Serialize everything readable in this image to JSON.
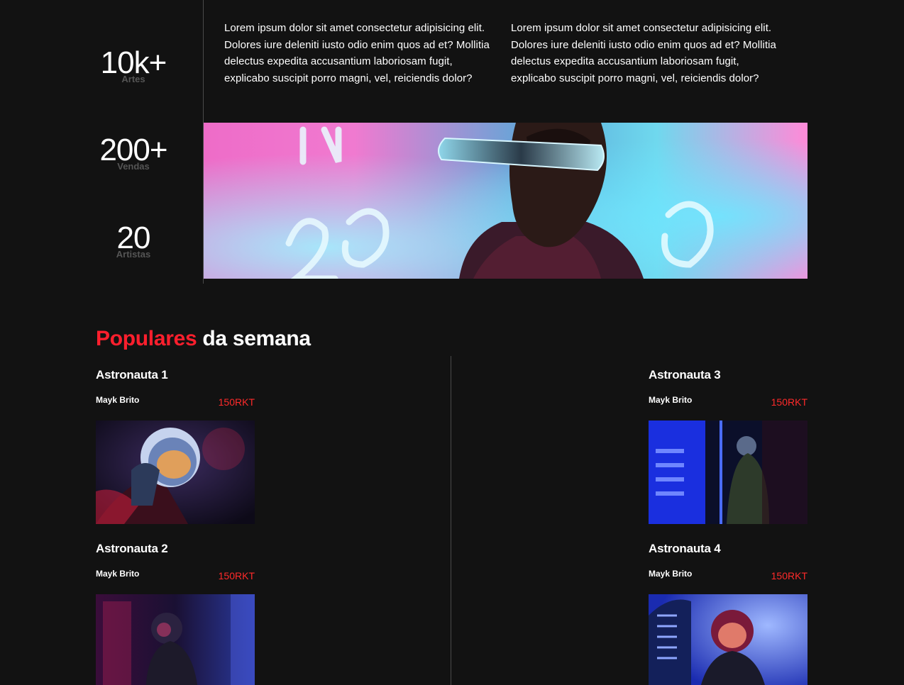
{
  "stats": [
    {
      "value": "10k+",
      "label": "Artes"
    },
    {
      "value": "200+",
      "label": "Vendas"
    },
    {
      "value": "20",
      "label": "Artistas"
    }
  ],
  "intro": {
    "paragraph_1": "Lorem ipsum dolor sit amet consectetur adipisicing elit. Dolores iure deleniti iusto odio enim quos ad et? Mollitia delectus expedita accusantium laboriosam fugit, explicabo suscipit porro magni, vel, reiciendis dolor?",
    "paragraph_2": "Lorem ipsum dolor sit amet consectetur adipisicing elit. Dolores iure deleniti iusto odio enim quos ad et? Mollitia delectus expedita accusantium laboriosam fugit, explicabo suscipit porro magni, vel, reiciendis dolor?"
  },
  "populares": {
    "title_accent": "Populares",
    "title_rest": " da semana",
    "items": [
      {
        "title": "Astronauta 1",
        "artist": "Mayk Brito",
        "price": "150RKT"
      },
      {
        "title": "Astronauta 2",
        "artist": "Mayk Brito",
        "price": "150RKT"
      },
      {
        "title": "Astronauta 3",
        "artist": "Mayk Brito",
        "price": "150RKT"
      },
      {
        "title": "Astronauta 4",
        "artist": "Mayk Brito",
        "price": "150RKT"
      }
    ]
  },
  "colors": {
    "background": "#121212",
    "accent": "#ff1f2d",
    "price": "#ff2a2a",
    "muted": "#555555",
    "divider": "#4a4a4a"
  }
}
